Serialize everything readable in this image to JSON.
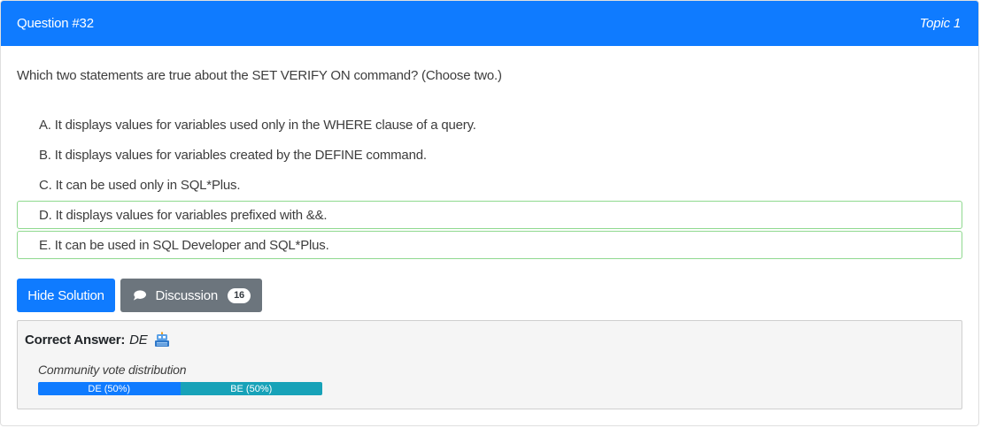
{
  "header": {
    "question": "Question #32",
    "topic": "Topic 1"
  },
  "question_text": "Which two statements are true about the SET VERIFY ON command? (Choose two.)",
  "choices": [
    {
      "text": "A. It displays values for variables used only in the WHERE clause of a query.",
      "correct": false
    },
    {
      "text": "B. It displays values for variables created by the DEFINE command.",
      "correct": false
    },
    {
      "text": "C. It can be used only in SQL*Plus.",
      "correct": false
    },
    {
      "text": "D. It displays values for variables prefixed with &&.",
      "correct": true
    },
    {
      "text": "E. It can be used in SQL Developer and SQL*Plus.",
      "correct": true
    }
  ],
  "buttons": {
    "solution": "Hide Solution",
    "discussion": "Discussion",
    "discussion_count": "16"
  },
  "answer": {
    "label": "Correct Answer:",
    "value": "DE",
    "reveal_icon": "robot-helper-icon"
  },
  "votes": {
    "title": "Community vote distribution",
    "items": [
      {
        "label": "DE (50%)",
        "percent": 50,
        "color": "#0f7bff"
      },
      {
        "label": "BE (50%)",
        "percent": 50,
        "color": "#17a2b8"
      }
    ]
  },
  "colors": {
    "primary": "#0f7bff",
    "secondary": "#6c757d",
    "correct_border": "#8fd98f",
    "info": "#17a2b8"
  }
}
